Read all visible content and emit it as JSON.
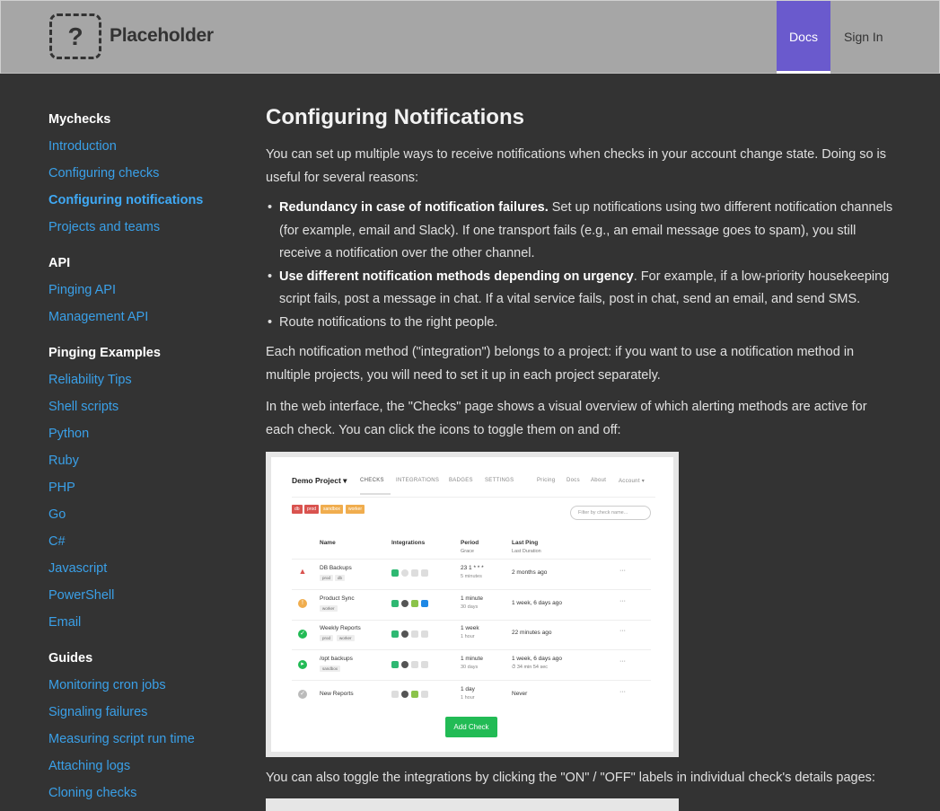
{
  "header": {
    "logo_glyph": "?",
    "brand": "Placeholder",
    "nav": {
      "docs": "Docs",
      "signin": "Sign In"
    },
    "accent_color": "#6a5acd"
  },
  "sidebar": {
    "sections": [
      {
        "title": "Mychecks",
        "items": [
          "Introduction",
          "Configuring checks",
          "Configuring notifications",
          "Projects and teams"
        ]
      },
      {
        "title": "API",
        "items": [
          "Pinging API",
          "Management API"
        ]
      },
      {
        "title": "Pinging Examples",
        "items": [
          "Reliability Tips",
          "Shell scripts",
          "Python",
          "Ruby",
          "PHP",
          "Go",
          "C#",
          "Javascript",
          "PowerShell",
          "Email"
        ]
      },
      {
        "title": "Guides",
        "items": [
          "Monitoring cron jobs",
          "Signaling failures",
          "Measuring script run time",
          "Attaching logs",
          "Cloning checks"
        ]
      }
    ],
    "active_item": "Configuring notifications"
  },
  "main": {
    "title": "Configuring Notifications",
    "intro": "You can set up multiple ways to receive notifications when checks in your account change state. Doing so is useful for several reasons:",
    "bullets": [
      {
        "bold": "Redundancy in case of notification failures.",
        "text": " Set up notifications using two different notification channels (for example, email and Slack). If one transport fails (e.g., an email message goes to spam), you still receive a notification over the other channel."
      },
      {
        "bold": "Use different notification methods depending on urgency",
        "text": ". For example, if a low-priority housekeeping script fails, post a message in chat. If a vital service fails, post in chat, send an email, and send SMS."
      },
      {
        "bold": "",
        "text": "Route notifications to the right people."
      }
    ],
    "p2": "Each notification method (\"integration\") belongs to a project: if you want to use a notification method in multiple projects, you will need to set it up in each project separately.",
    "p3": "In the web interface, the \"Checks\" page shows a visual overview of which alerting methods are active for each check. You can click the icons to toggle them on and off:",
    "p4": "You can also toggle the integrations by clicking the \"ON\" / \"OFF\" labels in individual check's details pages:"
  },
  "screenshot": {
    "project": "Demo Project ▾",
    "nav": [
      "CHECKS",
      "INTEGRATIONS",
      "BADGES",
      "SETTINGS"
    ],
    "nav_right": [
      "Pricing",
      "Docs",
      "About",
      "Account ▾"
    ],
    "tags": [
      "db",
      "prod",
      "sandbox",
      "worker"
    ],
    "filter_placeholder": "Filter by check name...",
    "headers": {
      "name": "Name",
      "integrations": "Integrations",
      "period": "Period",
      "grace": "Grace",
      "last_ping": "Last Ping",
      "last_duration": "Last Duration"
    },
    "rows": [
      {
        "name": "DB Backups",
        "tags": [
          "prod",
          "db"
        ],
        "period": "23 1 * * *",
        "grace": "5 minutes",
        "ping": "2 months ago",
        "duration": "",
        "status": "down"
      },
      {
        "name": "Product Sync",
        "tags": [
          "worker"
        ],
        "period": "1 minute",
        "grace": "30 days",
        "ping": "1 week, 6 days ago",
        "duration": "",
        "status": "grace"
      },
      {
        "name": "Weekly Reports",
        "tags": [
          "prod",
          "worker"
        ],
        "period": "1 week",
        "grace": "1 hour",
        "ping": "22 minutes ago",
        "duration": "",
        "status": "up"
      },
      {
        "name": "/opt backups",
        "tags": [
          "sandbox"
        ],
        "period": "1 minute",
        "grace": "30 days",
        "ping": "1 week, 6 days ago",
        "duration": "⏱ 34 min 54 sec",
        "status": "started"
      },
      {
        "name": "New Reports",
        "tags": [],
        "period": "1 day",
        "grace": "1 hour",
        "ping": "Never",
        "duration": "",
        "status": "new"
      }
    ],
    "row_menu": "···",
    "add_button": "Add Check"
  }
}
